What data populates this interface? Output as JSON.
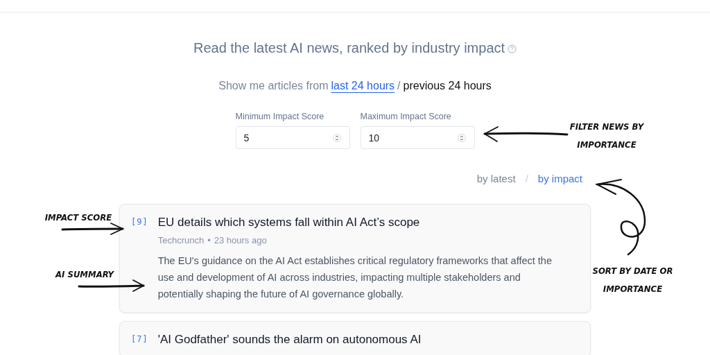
{
  "heading": {
    "text": "Read the latest AI news, ranked by industry impact"
  },
  "time_filter": {
    "prefix": "Show me articles from",
    "separator": "/",
    "options": [
      {
        "label": "last 24 hours",
        "selected": true
      },
      {
        "label": "previous 24 hours",
        "selected": false
      }
    ]
  },
  "score_fields": [
    {
      "label": "Minimum Impact Score",
      "value": "5"
    },
    {
      "label": "Maximum Impact Score",
      "value": "10"
    }
  ],
  "sort": {
    "separator": "/",
    "options": [
      {
        "label": "by latest",
        "selected": false
      },
      {
        "label": "by impact",
        "selected": true
      }
    ]
  },
  "articles": [
    {
      "score": "[9]",
      "title": "EU details which systems fall within AI Act’s scope",
      "source": "Techcrunch",
      "separator": "•",
      "time": "23 hours ago",
      "summary": "The EU's guidance on the AI Act establishes critical regulatory frameworks that affect the use and development of AI across industries, impacting multiple stakeholders and potentially shaping the future of AI governance globally."
    },
    {
      "score": "[7]",
      "title": "'AI Godfather' sounds the alarm on autonomous AI"
    }
  ],
  "annotations": [
    {
      "text": "FILTER NEWS BY IMPORTANCE"
    },
    {
      "text": "SORT BY DATE OR IMPORTANCE"
    },
    {
      "text": "IMPACT SCORE"
    },
    {
      "text": "AI SUMMARY"
    }
  ]
}
